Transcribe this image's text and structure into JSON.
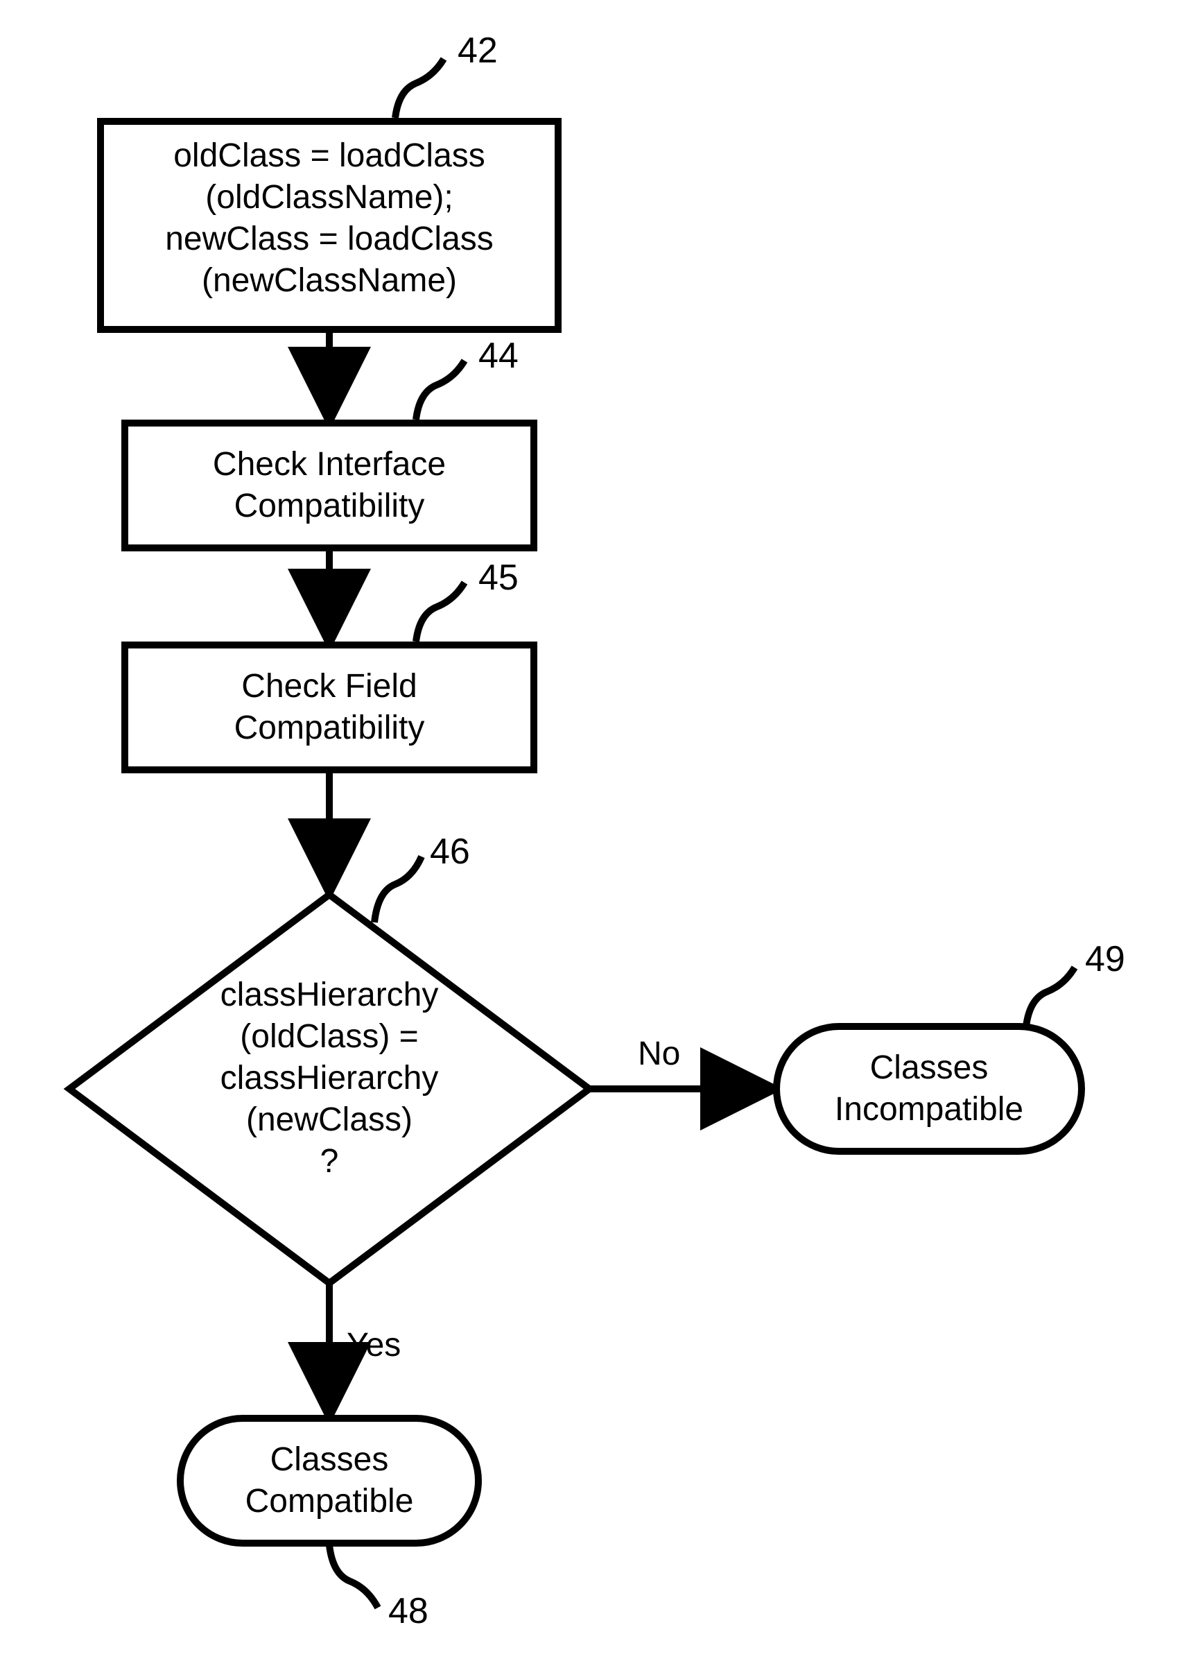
{
  "nodes": {
    "42": {
      "label": "42",
      "line1": "oldClass = loadClass",
      "line2": "(oldClassName);",
      "line3": "newClass = loadClass",
      "line4": "(newClassName)"
    },
    "44": {
      "label": "44",
      "line1": "Check Interface",
      "line2": "Compatibility"
    },
    "45": {
      "label": "45",
      "line1": "Check Field",
      "line2": "Compatibility"
    },
    "46": {
      "label": "46",
      "line1": "classHierarchy",
      "line2": "(oldClass) =",
      "line3": "classHierarchy",
      "line4": "(newClass)",
      "line5": "?"
    },
    "48": {
      "label": "48",
      "line1": "Classes",
      "line2": "Compatible"
    },
    "49": {
      "label": "49",
      "line1": "Classes",
      "line2": "Incompatible"
    }
  },
  "edges": {
    "yes": "Yes",
    "no": "No"
  }
}
